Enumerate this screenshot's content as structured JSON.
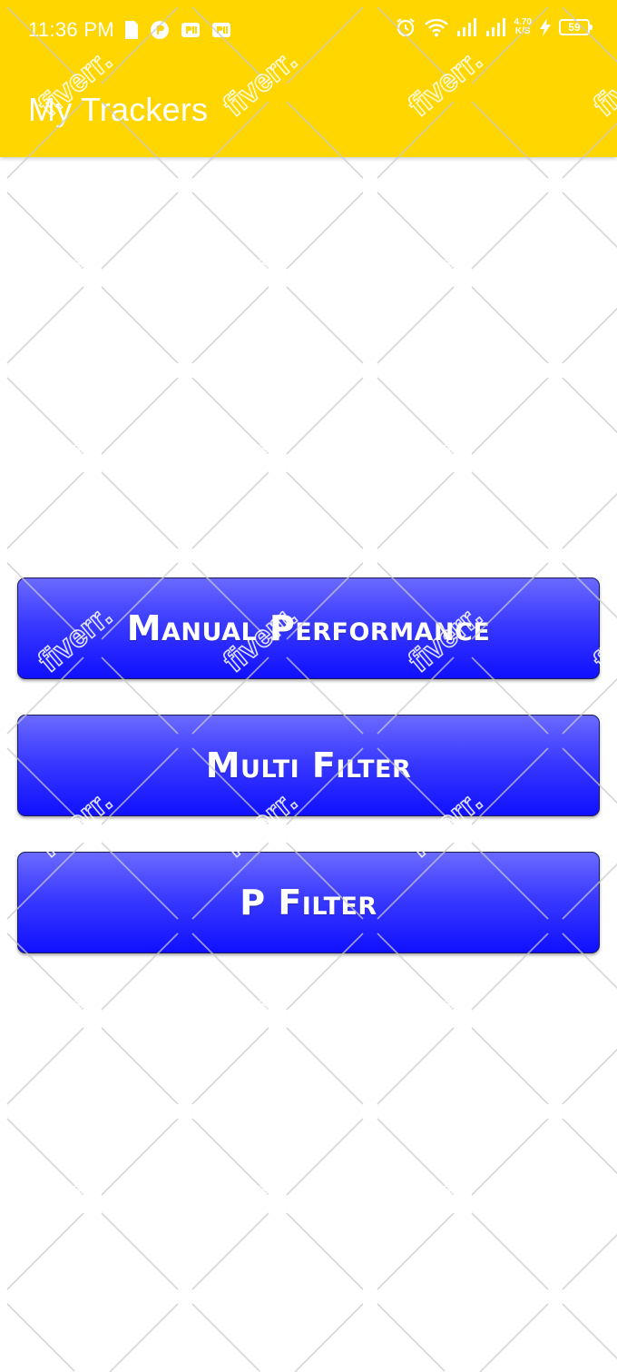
{
  "status_bar": {
    "time": "11:36 PM",
    "net_speed_value": "4.70",
    "net_speed_unit": "K/S",
    "battery": "59"
  },
  "app_bar": {
    "title": "My Trackers",
    "background_color": "#FFD600"
  },
  "buttons": [
    {
      "label": "Manual Performance"
    },
    {
      "label": "Multi Filter"
    },
    {
      "label": "P Filter"
    }
  ],
  "button_color": "#2a2aff",
  "watermark": {
    "text": "fiverr."
  }
}
